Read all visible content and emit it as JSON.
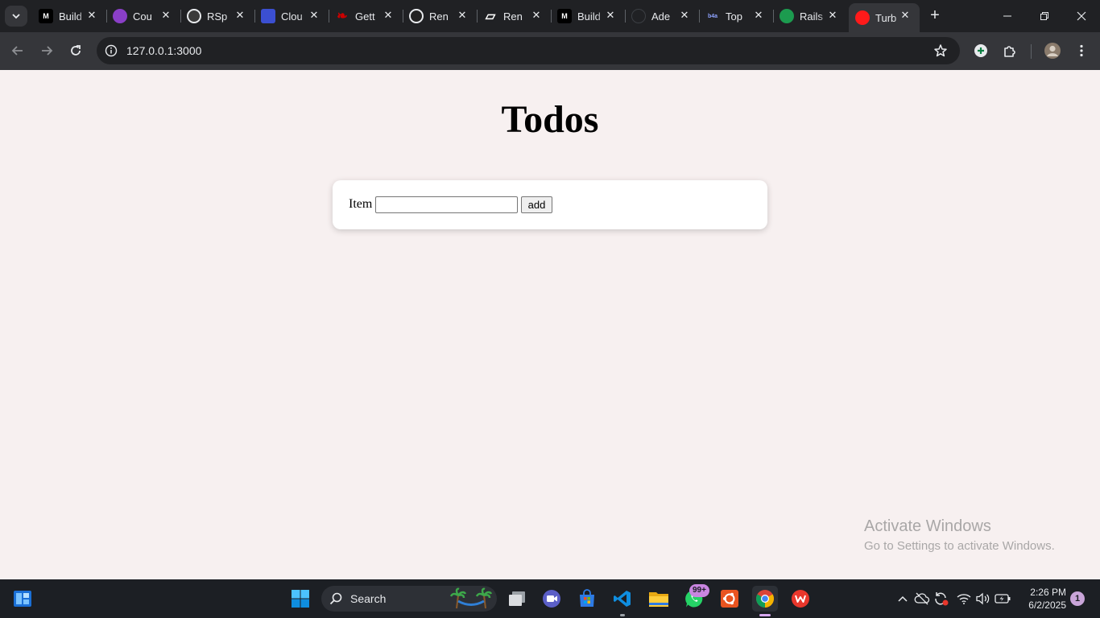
{
  "browser": {
    "tabs": [
      {
        "title": "Build",
        "icon": "medium-icon",
        "color": "#000000",
        "glyph": "M"
      },
      {
        "title": "Cou",
        "icon": "shield-icon",
        "color": "#8a3fc7",
        "glyph": ""
      },
      {
        "title": "RSp",
        "icon": "openai-icon",
        "color": "#3a3a3a",
        "glyph": ""
      },
      {
        "title": "Clou",
        "icon": "cloud-icon",
        "color": "#3b4fd1",
        "glyph": ""
      },
      {
        "title": "Gett",
        "icon": "rails-icon",
        "color": "#cc0000",
        "glyph": ""
      },
      {
        "title": "Ren",
        "icon": "render-icon",
        "color": "#222222",
        "glyph": ""
      },
      {
        "title": "Ren",
        "icon": "render-logo-icon",
        "color": "#ffffff",
        "glyph": ""
      },
      {
        "title": "Build",
        "icon": "medium-icon",
        "color": "#000000",
        "glyph": "M"
      },
      {
        "title": "Ade",
        "icon": "github-icon",
        "color": "#202124",
        "glyph": ""
      },
      {
        "title": "Top",
        "icon": "b4a-icon",
        "color": "#1e2a6e",
        "glyph": "b4a"
      },
      {
        "title": "Rails",
        "icon": "rails-green-icon",
        "color": "#1c9b4f",
        "glyph": ""
      },
      {
        "title": "Turb",
        "icon": "turbo-red-dot-icon",
        "color": "#ff1a1a",
        "glyph": ""
      }
    ],
    "active_tab": 11,
    "url": "127.0.0.1:3000"
  },
  "page": {
    "heading": "Todos",
    "form": {
      "label": "Item",
      "input_value": "",
      "button_label": "add"
    },
    "watermark": {
      "line1": "Activate Windows",
      "line2": "Go to Settings to activate Windows."
    }
  },
  "taskbar": {
    "search_label": "Search",
    "whatsapp_badge": "99+",
    "time": "2:26 PM",
    "date": "6/2/2025",
    "notification_count": "1"
  }
}
